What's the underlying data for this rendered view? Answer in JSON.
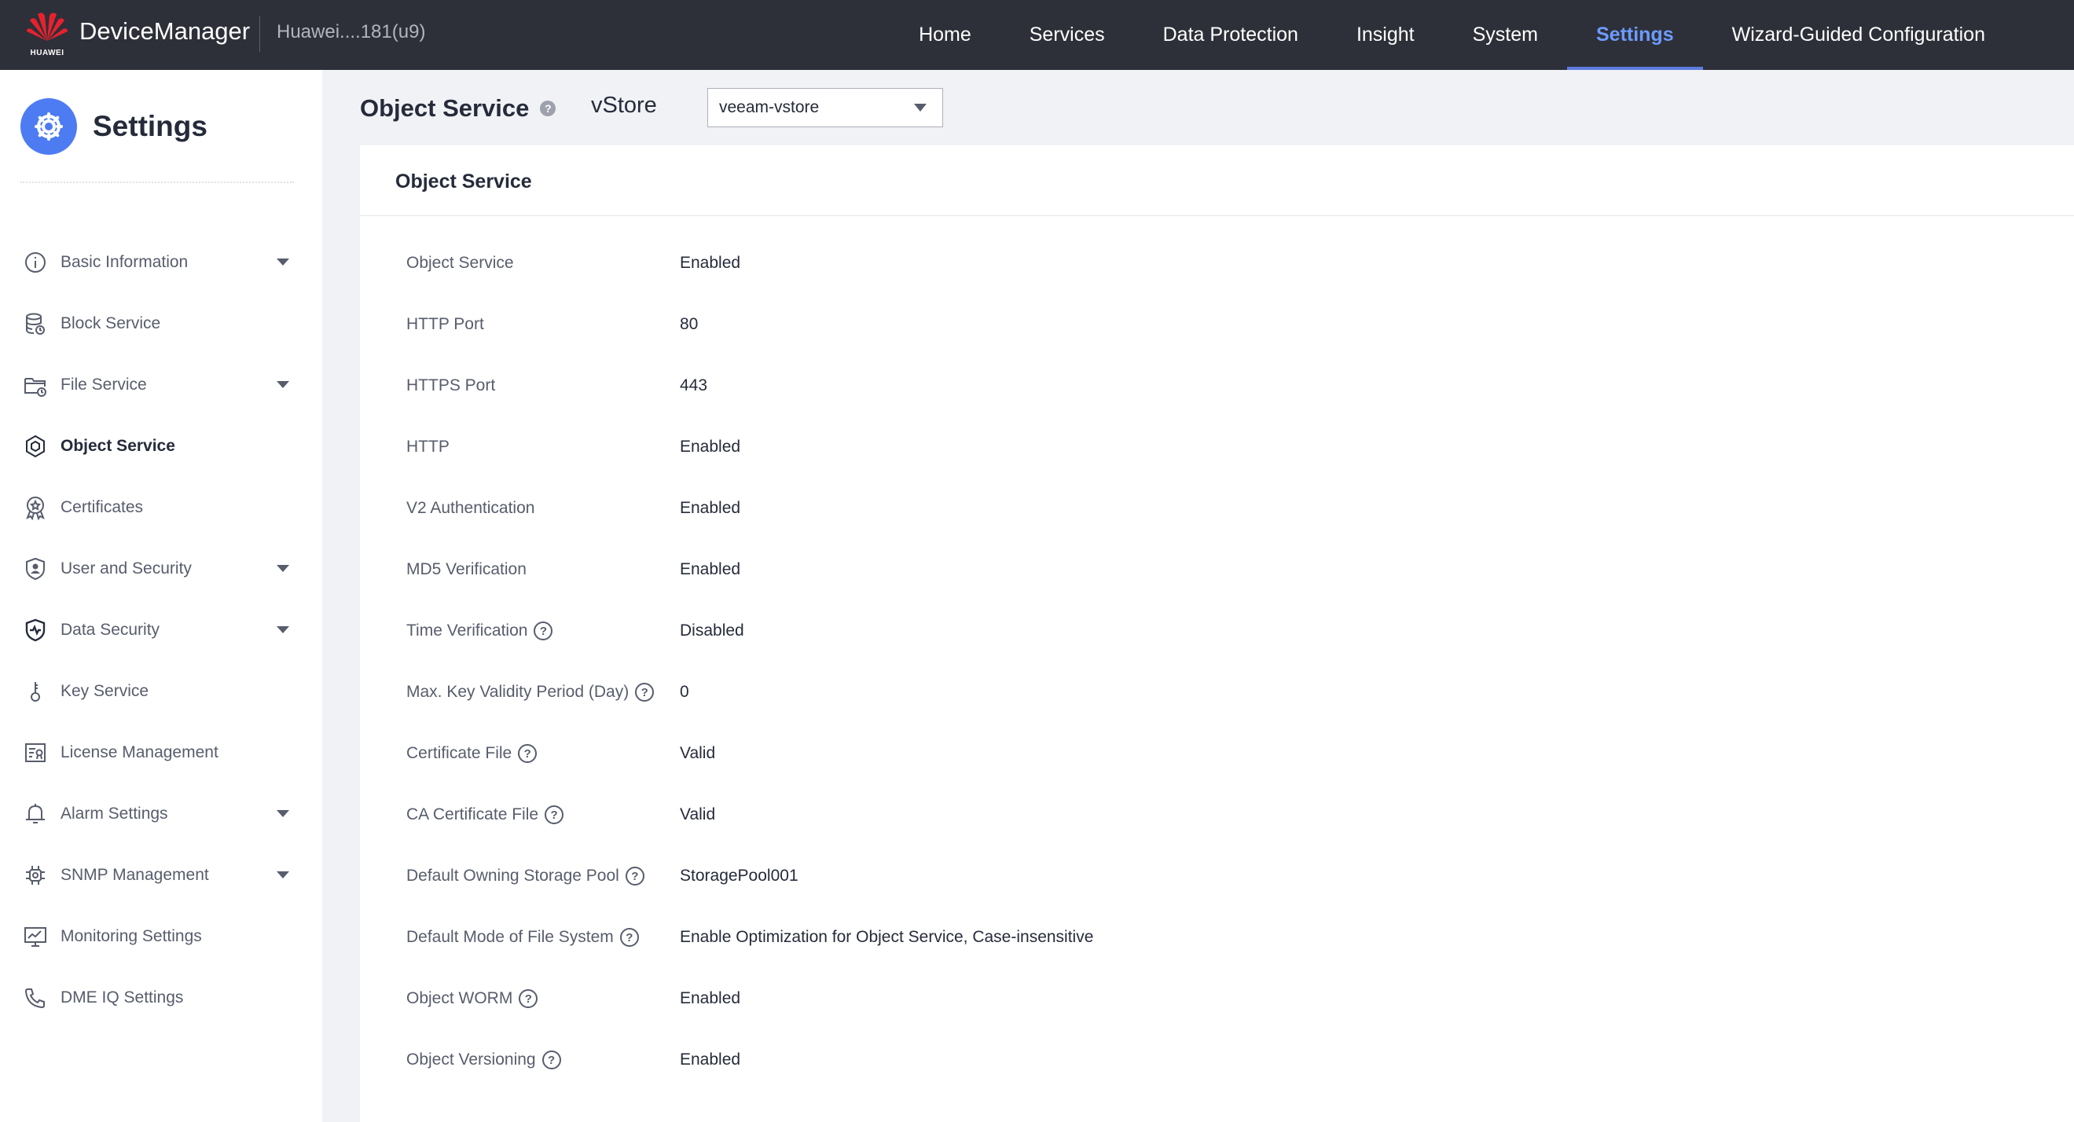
{
  "topbar": {
    "brand": "HUAWEI",
    "app_title": "DeviceManager",
    "device_name": "Huawei....181(u9)",
    "nav": [
      {
        "label": "Home",
        "active": false
      },
      {
        "label": "Services",
        "active": false
      },
      {
        "label": "Data Protection",
        "active": false
      },
      {
        "label": "Insight",
        "active": false
      },
      {
        "label": "System",
        "active": false
      },
      {
        "label": "Settings",
        "active": true
      },
      {
        "label": "Wizard-Guided Configuration",
        "active": false
      }
    ]
  },
  "sidebar": {
    "title": "Settings",
    "items": [
      {
        "label": "Basic Information",
        "icon": "info-icon",
        "expandable": true,
        "active": false
      },
      {
        "label": "Block Service",
        "icon": "database-icon",
        "expandable": false,
        "active": false
      },
      {
        "label": "File Service",
        "icon": "folder-icon",
        "expandable": true,
        "active": false
      },
      {
        "label": "Object Service",
        "icon": "cube-icon",
        "expandable": false,
        "active": true
      },
      {
        "label": "Certificates",
        "icon": "certificate-icon",
        "expandable": false,
        "active": false
      },
      {
        "label": "User and Security",
        "icon": "shield-user-icon",
        "expandable": true,
        "active": false
      },
      {
        "label": "Data Security",
        "icon": "shield-check-icon",
        "expandable": true,
        "active": false
      },
      {
        "label": "Key Service",
        "icon": "key-icon",
        "expandable": false,
        "active": false
      },
      {
        "label": "License Management",
        "icon": "license-icon",
        "expandable": false,
        "active": false
      },
      {
        "label": "Alarm Settings",
        "icon": "bell-icon",
        "expandable": true,
        "active": false
      },
      {
        "label": "SNMP Management",
        "icon": "chip-icon",
        "expandable": true,
        "active": false
      },
      {
        "label": "Monitoring Settings",
        "icon": "monitor-icon",
        "expandable": false,
        "active": false
      },
      {
        "label": "DME IQ Settings",
        "icon": "phone-icon",
        "expandable": false,
        "active": false
      }
    ]
  },
  "content": {
    "page_title": "Object Service",
    "vstore_label": "vStore",
    "vstore_value": "veeam-vstore",
    "card_title": "Object Service",
    "rows": [
      {
        "label": "Object Service",
        "value": "Enabled",
        "help": false
      },
      {
        "label": "HTTP Port",
        "value": "80",
        "help": false
      },
      {
        "label": "HTTPS Port",
        "value": "443",
        "help": false
      },
      {
        "label": "HTTP",
        "value": "Enabled",
        "help": false
      },
      {
        "label": "V2 Authentication",
        "value": "Enabled",
        "help": false
      },
      {
        "label": "MD5 Verification",
        "value": "Enabled",
        "help": false
      },
      {
        "label": "Time Verification",
        "value": "Disabled",
        "help": true
      },
      {
        "label": "Max. Key Validity Period (Day)",
        "value": "0",
        "help": true
      },
      {
        "label": "Certificate File",
        "value": "Valid",
        "help": true
      },
      {
        "label": "CA Certificate File",
        "value": "Valid",
        "help": true
      },
      {
        "label": "Default Owning Storage Pool",
        "value": "StoragePool001",
        "help": true
      },
      {
        "label": "Default Mode of File System",
        "value": "Enable Optimization for Object Service, Case-insensitive",
        "help": true
      },
      {
        "label": "Object WORM",
        "value": "Enabled",
        "help": true
      },
      {
        "label": "Object Versioning",
        "value": "Enabled",
        "help": true
      }
    ]
  },
  "colors": {
    "topbar_bg": "#2d3038",
    "accent": "#5e7ce0",
    "active_nav": "#6d9bff",
    "logo_red": "#e8212e"
  }
}
